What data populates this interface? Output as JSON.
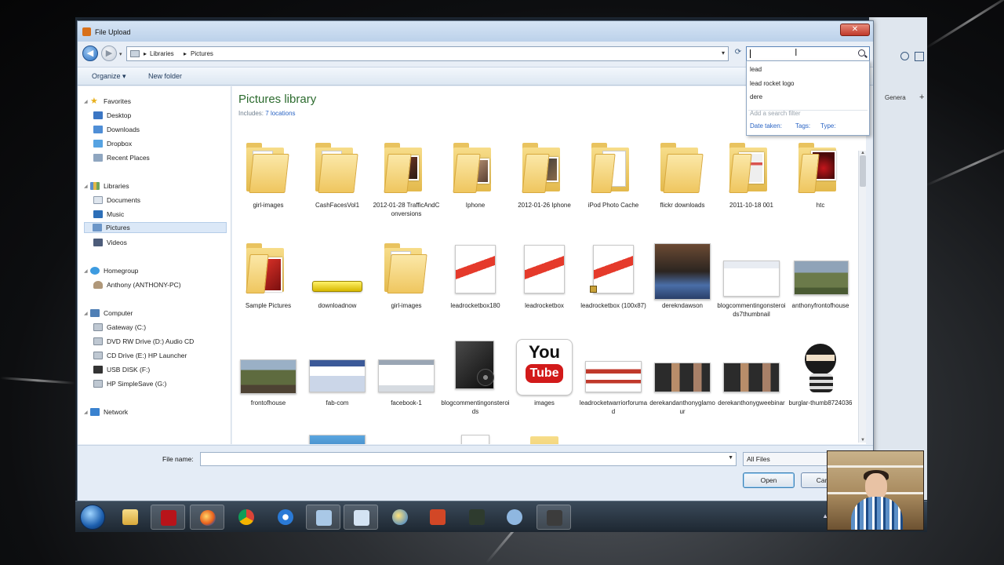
{
  "dialog": {
    "title": "File Upload",
    "close_label": "✕",
    "breadcrumb": [
      "Libraries",
      "Pictures"
    ],
    "search": {
      "value": "",
      "suggestions": [
        "lead",
        "lead rocket logo",
        "dere"
      ],
      "add_filter_hint": "Add a search filter",
      "filters": [
        "Date taken:",
        "Tags:",
        "Type:"
      ]
    },
    "toolbar": {
      "organize": "Organize ▾",
      "new_folder": "New folder"
    },
    "nav": {
      "favorites": "Favorites",
      "favorites_items": [
        "Desktop",
        "Downloads",
        "Dropbox",
        "Recent Places"
      ],
      "libraries": "Libraries",
      "libraries_items": [
        "Documents",
        "Music",
        "Pictures",
        "Videos"
      ],
      "homegroup": "Homegroup",
      "homegroup_items": [
        "Anthony (ANTHONY-PC)"
      ],
      "computer": "Computer",
      "computer_items": [
        "Gateway (C:)",
        "DVD RW Drive (D:) Audio CD",
        "CD Drive (E:) HP Launcher",
        "USB DISK (F:)",
        "HP SimpleSave (G:)"
      ],
      "network": "Network"
    },
    "library": {
      "title": "Pictures library",
      "includes_label": "Includes:",
      "locations_link": "7 locations"
    },
    "items": [
      [
        "girl-images",
        "CashFacesVol1",
        "2012-01-28 TrafficAndConversions",
        "Iphone",
        "2012-01-26 Iphone",
        "iPod Photo Cache",
        "flickr downloads",
        "2011-10-18 001",
        "htc"
      ],
      [
        "Sample Pictures",
        "downloadnow",
        "girl-images",
        "leadrocketbox180",
        "leadrocketbox",
        "leadrocketbox (100x87)",
        "derekndawson",
        "blogcommentingonsteroids7thumbnail",
        "anthonyfrontofhouse"
      ],
      [
        "frontofhouse",
        "fab-com",
        "facebook-1",
        "blogcommentingonsteroids",
        "images",
        "leadrocketwarriorforumad",
        "derekandanthonyglamour",
        "derekanthonygweebinar",
        "burglar-thumb8724036"
      ]
    ],
    "youtube": {
      "you": "You",
      "tube": "Tube"
    },
    "file_name_label": "File name:",
    "file_name_value": "",
    "file_type": "All Files",
    "open_label": "Open",
    "cancel_label": "Cancel"
  },
  "browser": {
    "tab_label": "Genera",
    "new_tab": "+"
  },
  "colors": {
    "library_title": "#2c6b2e",
    "link": "#2a64c4",
    "taskbar": "#1d2731"
  }
}
